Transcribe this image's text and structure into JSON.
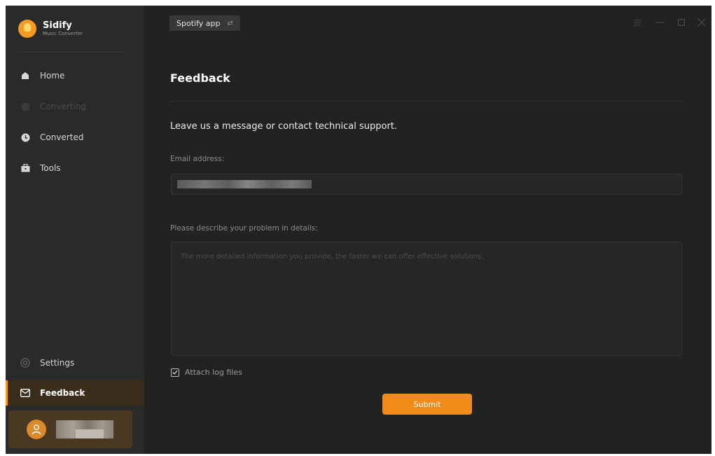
{
  "app": {
    "name": "Sidify",
    "subtitle": "Music Converter"
  },
  "sidebar": {
    "items": [
      {
        "label": "Home",
        "icon": "home-icon"
      },
      {
        "label": "Converting",
        "icon": "converting-icon"
      },
      {
        "label": "Converted",
        "icon": "clock-icon"
      },
      {
        "label": "Tools",
        "icon": "toolbox-icon"
      },
      {
        "label": "Settings",
        "icon": "gear-icon"
      },
      {
        "label": "Feedback",
        "icon": "mail-icon"
      }
    ]
  },
  "header": {
    "source_label": "Spotify app",
    "swap_icon": "swap-icon"
  },
  "page": {
    "title": "Feedback",
    "subtitle": "Leave us a message or contact technical support.",
    "email_label": "Email address:",
    "description_label": "Please describe your problem in details:",
    "description_placeholder": "The more detailed information you provide, the faster we can offer effective solutions.",
    "attach_label": "Attach log files",
    "attach_checked": true,
    "submit_label": "Submit"
  },
  "colors": {
    "accent": "#f59a23",
    "background": "#222222",
    "sidebar": "#2a2a2a"
  }
}
